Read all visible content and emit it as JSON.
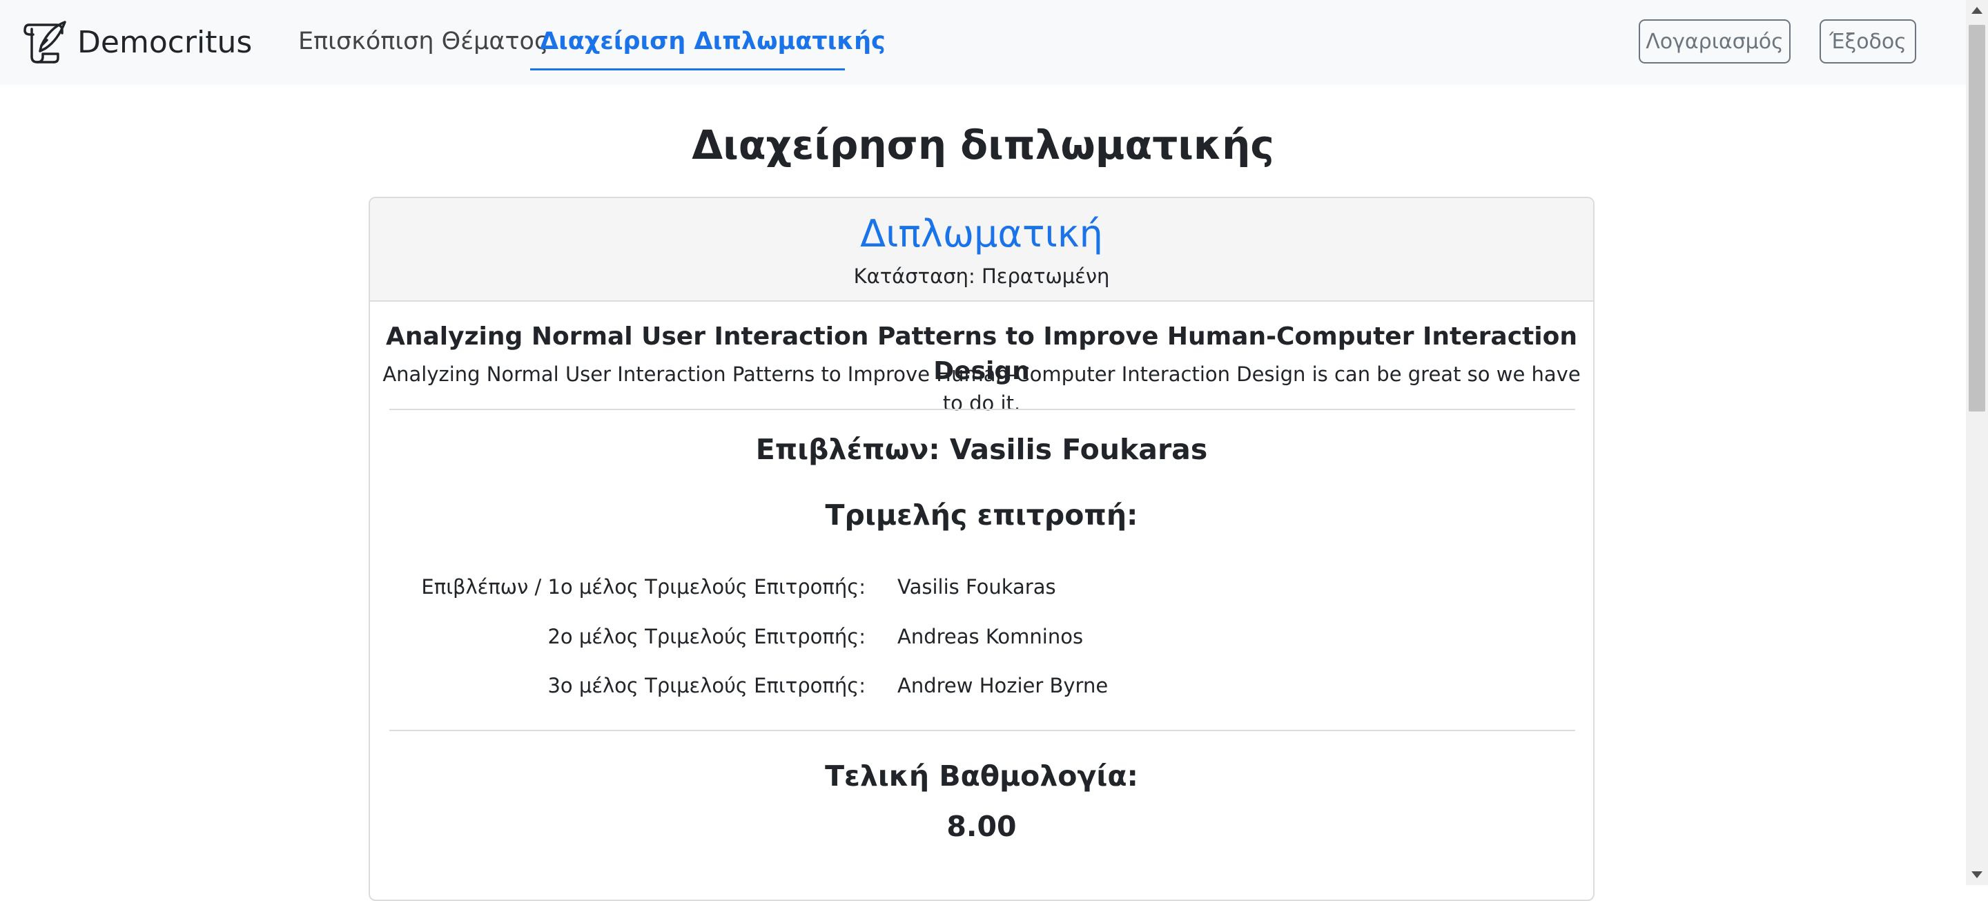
{
  "navbar": {
    "brand": "Democritus",
    "links": [
      "Επισκόπιση Θέματος",
      "Διαχείριση Διπλωματικής"
    ],
    "active_link_index": 1,
    "account_label": "Λογαριασμός",
    "logout_label": "Έξοδος",
    "brand_icon": "scroll-quill-icon"
  },
  "page": {
    "title": "Διαχείρηση διπλωματικής"
  },
  "card": {
    "header_title": "Διπλωματική",
    "status": "Κατάσταση: Περατωμένη",
    "thesis_title": "Analyzing Normal User Interaction Patterns to Improve Human-Computer Interaction Design",
    "thesis_description": "Analyzing Normal User Interaction Patterns to Improve Human-Computer Interaction Design is can be great so we have to do it.",
    "supervisor": "Επιβλέπων: Vasilis Foukaras",
    "committee_heading": "Τριμελής επιτροπή:",
    "committee": [
      {
        "label": "Επιβλέπων / 1ο μέλος Τριμελούς Επιτροπής:",
        "value": "Vasilis Foukaras"
      },
      {
        "label": "2ο μέλος Τριμελούς Επιτροπής:",
        "value": "Andreas Komninos"
      },
      {
        "label": "3ο μέλος Τριμελούς Επιτροπής:",
        "value": "Andrew Hozier Byrne"
      }
    ],
    "grade_heading": "Τελική Βαθμολογία:",
    "grade_value": "8.00"
  },
  "colors": {
    "accent": "#1a73e8",
    "navbar_bg": "#f8f9fa",
    "card_header_bg": "#f5f5f5",
    "text": "#212529",
    "muted_button": "#6c757d"
  }
}
